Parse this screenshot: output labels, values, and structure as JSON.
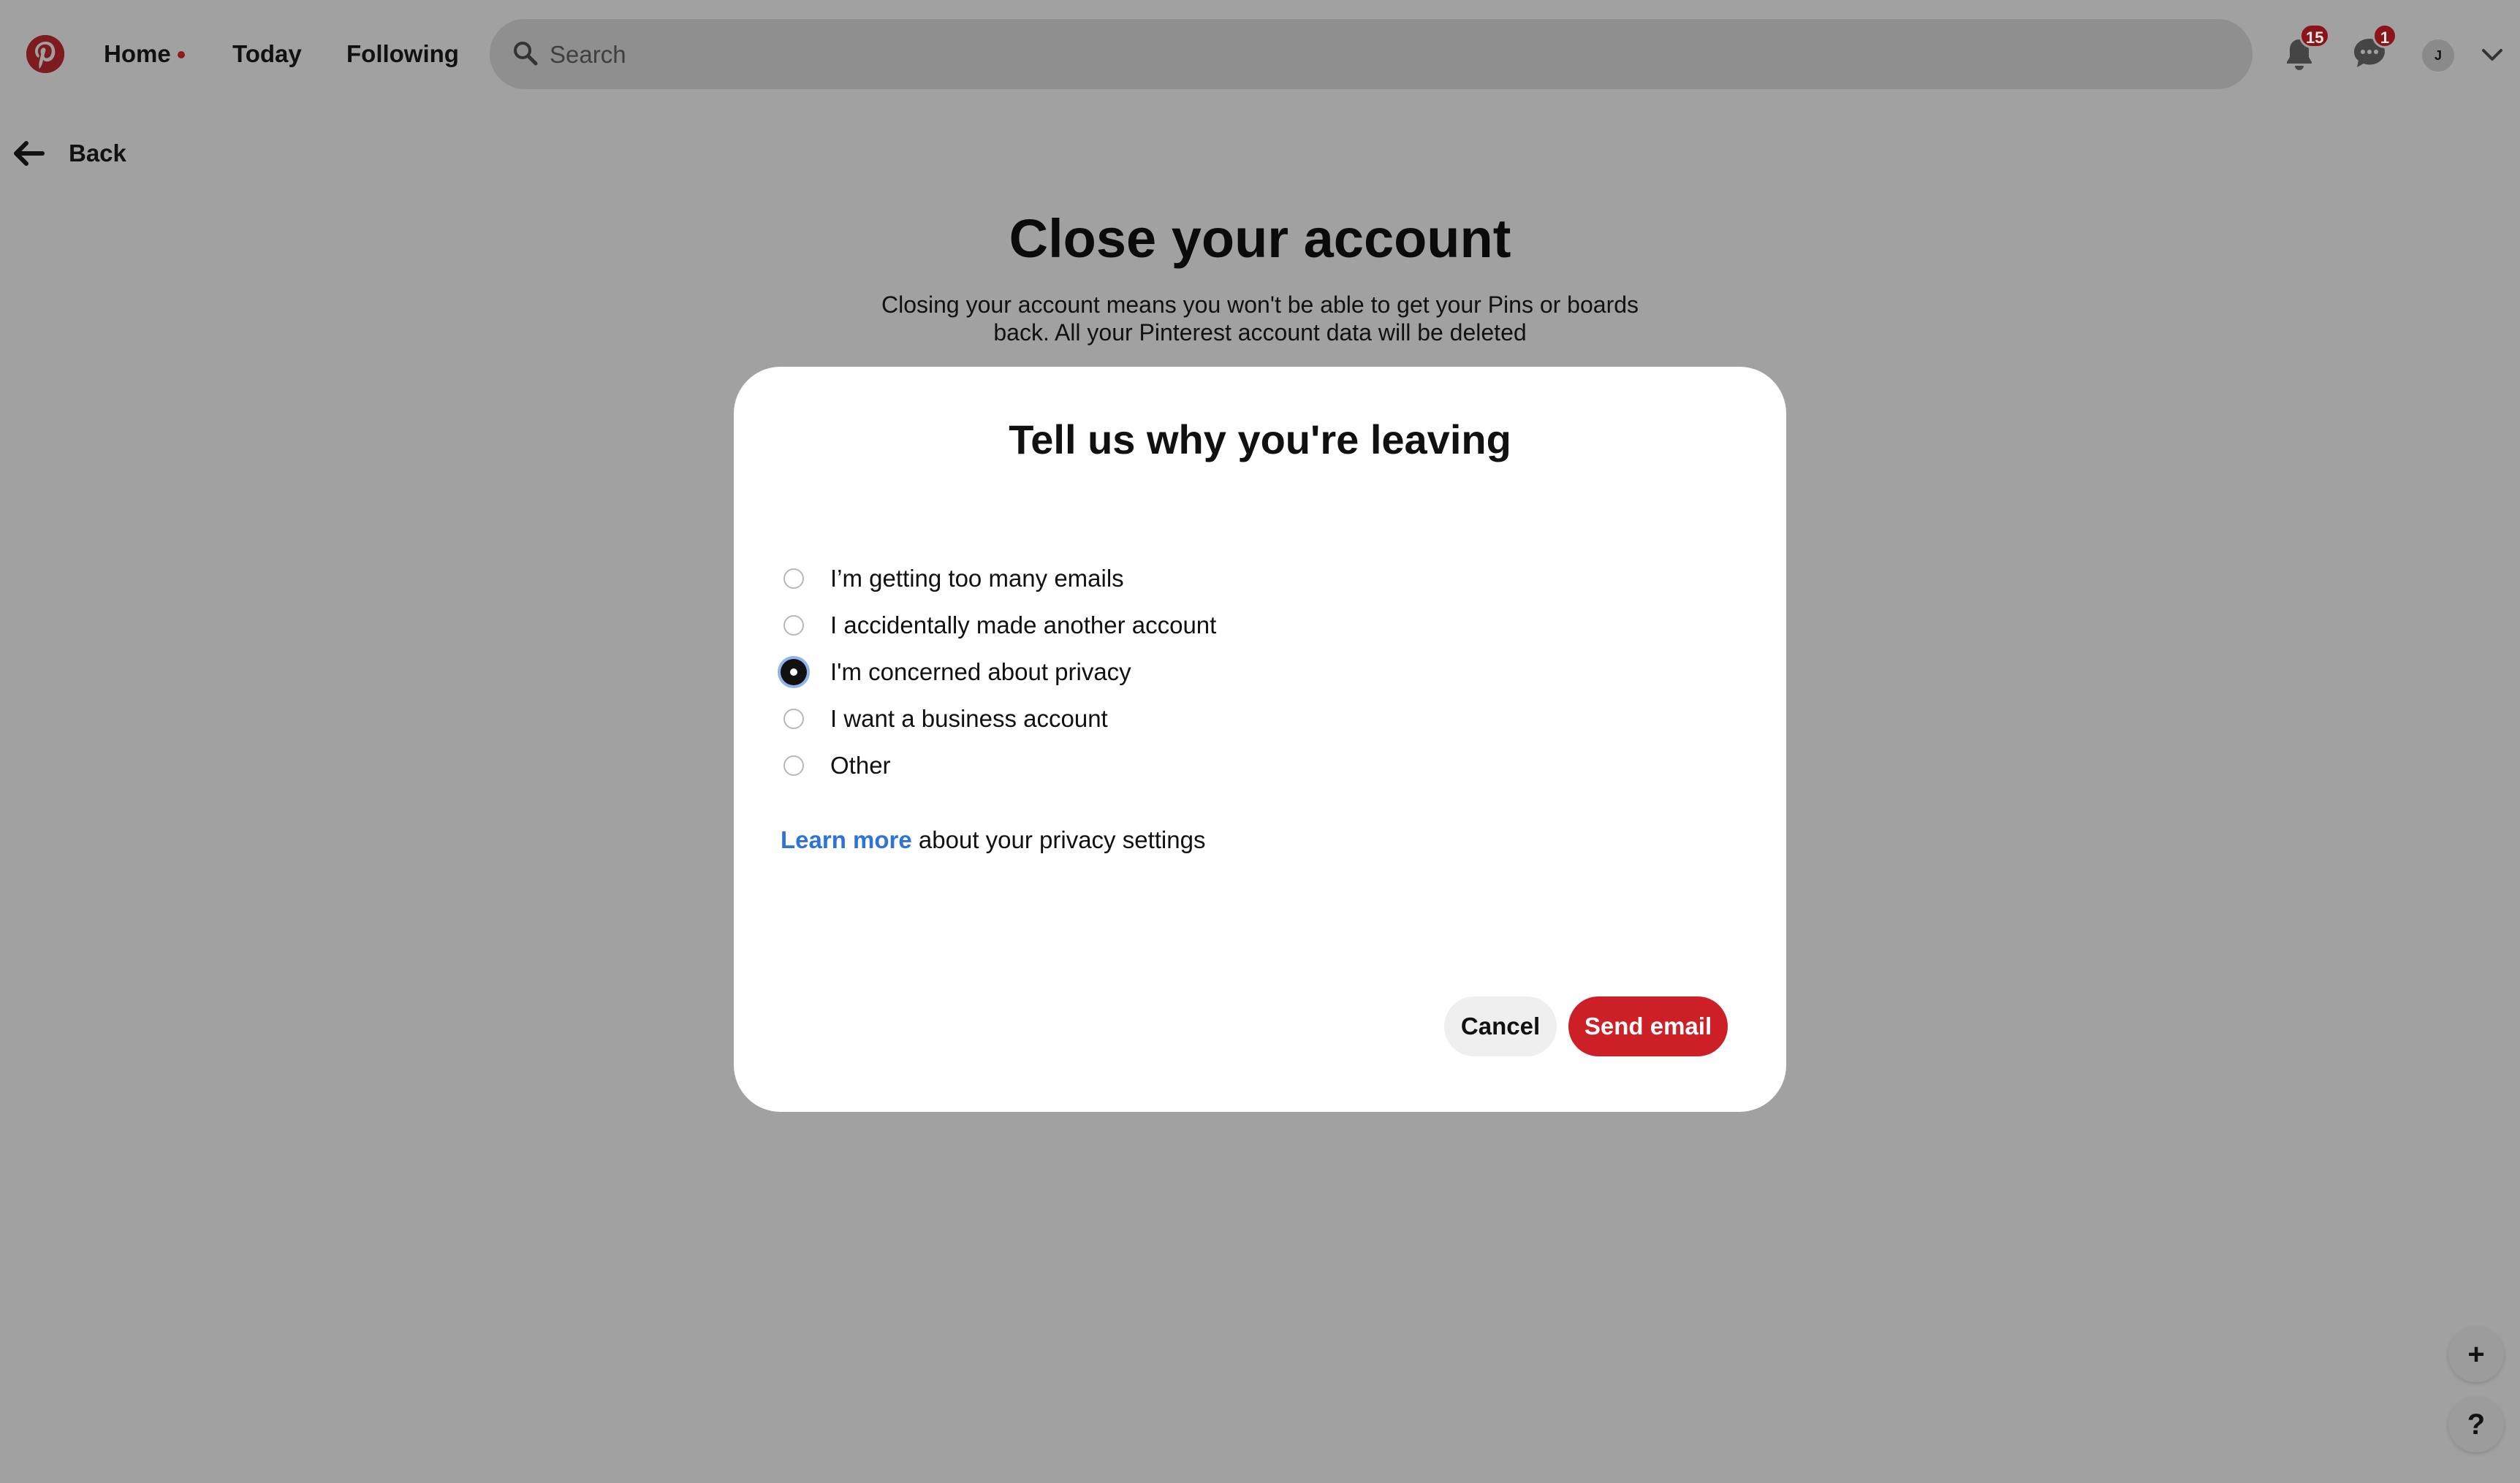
{
  "header": {
    "nav": {
      "home": "Home",
      "today": "Today",
      "following": "Following"
    },
    "search": {
      "placeholder": "Search"
    },
    "notifications": {
      "count": "15"
    },
    "messages": {
      "count": "1"
    },
    "avatar": {
      "initial": "J"
    }
  },
  "back": {
    "label": "Back"
  },
  "page": {
    "title": "Close your account",
    "subtitle": "Closing your account means you won't be able to get your Pins or boards back. All your Pinterest account data will be deleted"
  },
  "modal": {
    "title": "Tell us why you're leaving",
    "options": [
      {
        "label": "I’m getting too many emails",
        "selected": false
      },
      {
        "label": "I accidentally made another account",
        "selected": false
      },
      {
        "label": "I'm concerned about privacy",
        "selected": true
      },
      {
        "label": "I want a business account",
        "selected": false
      },
      {
        "label": "Other",
        "selected": false
      }
    ],
    "learn_more": {
      "link": "Learn more",
      "text": " about your privacy settings"
    },
    "cancel_label": "Cancel",
    "send_label": "Send email"
  },
  "floating": {
    "plus": "+",
    "help": "?"
  },
  "colors": {
    "brand_red": "#cc1f26",
    "link_blue": "#2d73d9",
    "overlay": "#a1a1a1"
  }
}
